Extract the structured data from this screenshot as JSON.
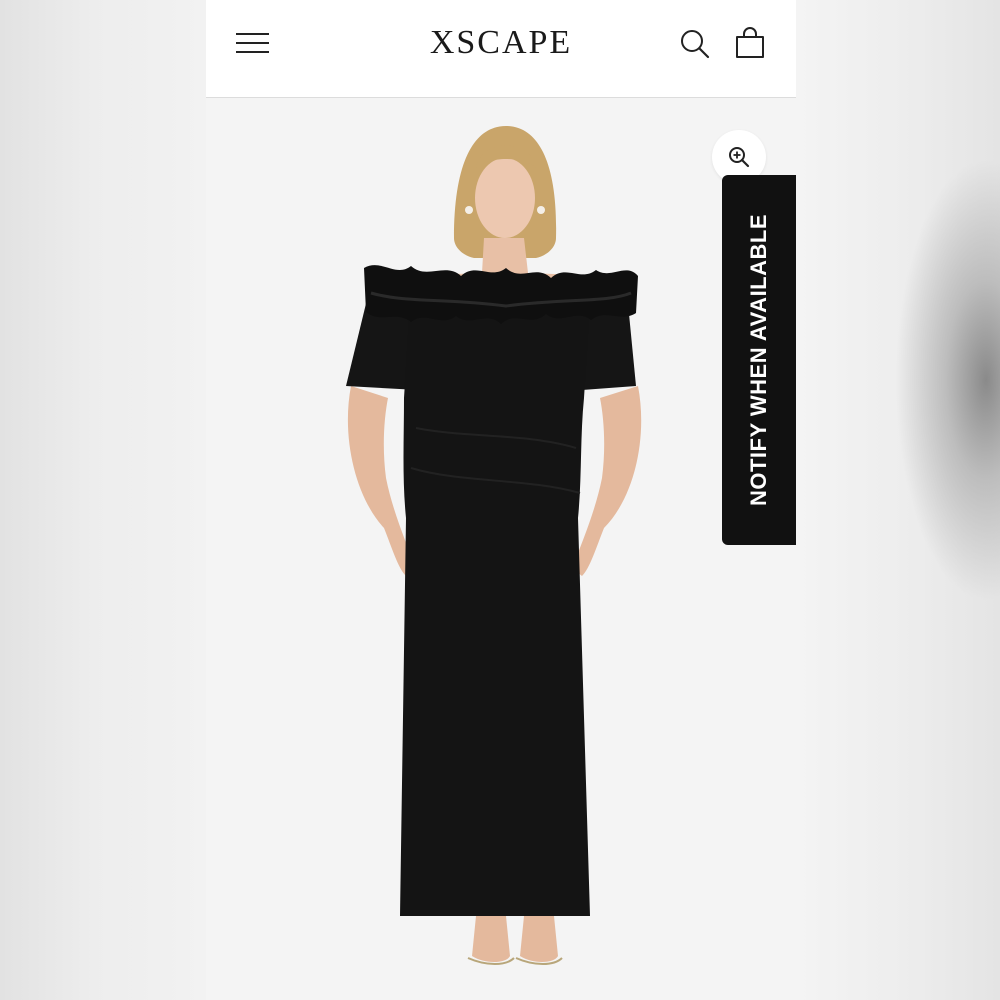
{
  "header": {
    "logo": "XSCAPE",
    "menu_icon": "hamburger-menu-icon",
    "search_icon": "search-icon",
    "bag_icon": "shopping-bag-icon"
  },
  "product": {
    "zoom_icon": "zoom-in-icon",
    "notify_label": "NOTIFY WHEN AVAILABLE"
  },
  "colors": {
    "header_bg": "#ffffff",
    "image_bg": "#f4f4f4",
    "notify_bg": "#111111",
    "notify_text": "#ffffff",
    "dress": "#141414"
  }
}
